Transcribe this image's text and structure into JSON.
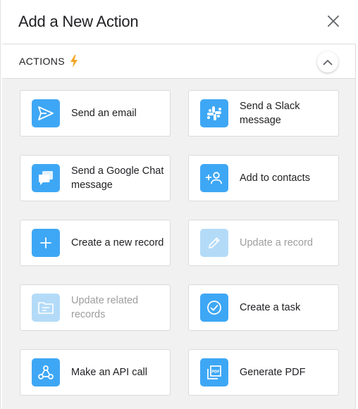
{
  "dialog": {
    "title": "Add a New Action"
  },
  "section": {
    "label": "ACTIONS",
    "accent_color": "#f5a623",
    "icon": "bolt-icon"
  },
  "colors": {
    "icon_bg": "#3ea7f5",
    "icon_bg_disabled": "#b3dbf8",
    "grid_bg": "#f1f1f1"
  },
  "actions": [
    {
      "label": "Send an email",
      "icon": "send-icon",
      "enabled": true
    },
    {
      "label": "Send a Slack message",
      "icon": "slack-icon",
      "enabled": true
    },
    {
      "label": "Send a Google Chat message",
      "icon": "chat-icon",
      "enabled": true
    },
    {
      "label": "Add to contacts",
      "icon": "add-contact-icon",
      "enabled": true
    },
    {
      "label": "Create a new record",
      "icon": "plus-icon",
      "enabled": true
    },
    {
      "label": "Update a record",
      "icon": "pencil-icon",
      "enabled": false
    },
    {
      "label": "Update related records",
      "icon": "related-records-icon",
      "enabled": false
    },
    {
      "label": "Create a task",
      "icon": "check-circle-icon",
      "enabled": true
    },
    {
      "label": "Make an API call",
      "icon": "webhook-icon",
      "enabled": true
    },
    {
      "label": "Generate PDF",
      "icon": "pdf-icon",
      "enabled": true
    }
  ]
}
